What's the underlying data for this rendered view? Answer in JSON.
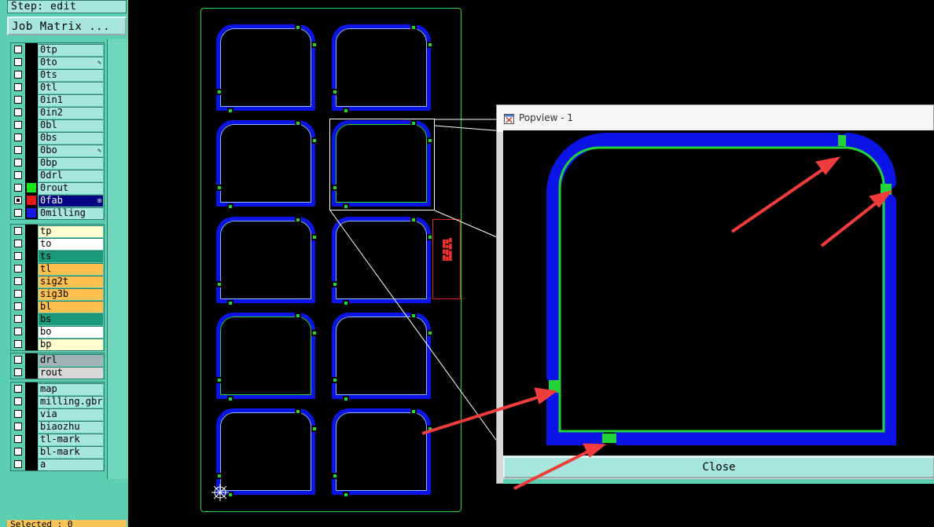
{
  "panel": {
    "step_label": "Step: edit",
    "job_matrix_button": "Job Matrix ...",
    "selected_label": "Selected : 0"
  },
  "layer_groups": [
    [
      {
        "name": "0tp",
        "checked": false,
        "color": "",
        "mark": ""
      },
      {
        "name": "0to",
        "checked": false,
        "color": "",
        "mark": "pencil"
      },
      {
        "name": "0ts",
        "checked": false,
        "color": "",
        "mark": ""
      },
      {
        "name": "0tl",
        "checked": false,
        "color": "",
        "mark": ""
      },
      {
        "name": "0in1",
        "checked": false,
        "color": "",
        "mark": ""
      },
      {
        "name": "0in2",
        "checked": false,
        "color": "",
        "mark": ""
      },
      {
        "name": "0bl",
        "checked": false,
        "color": "",
        "mark": ""
      },
      {
        "name": "0bs",
        "checked": false,
        "color": "",
        "mark": ""
      },
      {
        "name": "0bo",
        "checked": false,
        "color": "",
        "mark": "pencil"
      },
      {
        "name": "0bp",
        "checked": false,
        "color": "",
        "mark": ""
      },
      {
        "name": "0drl",
        "checked": false,
        "color": "",
        "mark": ""
      },
      {
        "name": "0rout",
        "checked": false,
        "color": "#19e619",
        "mark": ""
      },
      {
        "name": "0fab",
        "checked": true,
        "color": "#e61919",
        "mark": "grid",
        "name_bg": "#000080",
        "name_color": "#ffffff"
      },
      {
        "name": "0milling",
        "checked": false,
        "color": "#1919e6",
        "mark": ""
      }
    ],
    [
      {
        "name": "tp",
        "checked": false,
        "color": "",
        "name_bg": "#ffffd2"
      },
      {
        "name": "to",
        "checked": false,
        "color": "",
        "name_bg": "#ffffff"
      },
      {
        "name": "ts",
        "checked": false,
        "color": "",
        "name_bg": "#1a9a78"
      },
      {
        "name": "tl",
        "checked": false,
        "color": "",
        "name_bg": "#ffc050"
      },
      {
        "name": "sig2t",
        "checked": false,
        "color": "",
        "name_bg": "#ffc050"
      },
      {
        "name": "sig3b",
        "checked": false,
        "color": "",
        "name_bg": "#ffc050"
      },
      {
        "name": "bl",
        "checked": false,
        "color": "",
        "name_bg": "#ffc050"
      },
      {
        "name": "bs",
        "checked": false,
        "color": "",
        "name_bg": "#1a9a78"
      },
      {
        "name": "bo",
        "checked": false,
        "color": "",
        "name_bg": "#ffffff"
      },
      {
        "name": "bp",
        "checked": false,
        "color": "",
        "name_bg": "#ffffd2"
      }
    ],
    [
      {
        "name": "drl",
        "checked": false,
        "color": "",
        "name_bg": "#a0b4b4"
      },
      {
        "name": "rout",
        "checked": false,
        "color": "",
        "name_bg": "#d8d8d8"
      }
    ],
    [
      {
        "name": "map",
        "checked": false,
        "color": ""
      },
      {
        "name": "milling.gbr",
        "checked": false,
        "color": ""
      },
      {
        "name": "via",
        "checked": false,
        "color": ""
      },
      {
        "name": "biaozhu",
        "checked": false,
        "color": ""
      },
      {
        "name": "tl-mark",
        "checked": false,
        "color": ""
      },
      {
        "name": "bl-mark",
        "checked": false,
        "color": ""
      },
      {
        "name": "a",
        "checked": false,
        "color": ""
      }
    ]
  ],
  "popview": {
    "title": "Popview - 1",
    "close_label": "Close"
  },
  "colors": {
    "milling": "#0a14e6",
    "rout": "#22d33a",
    "arrow": "#f03c3c",
    "panel_bg": "#5ccfb0"
  },
  "icons": [
    "pencil-icon",
    "grid-icon",
    "popview-window-icon",
    "origin-crosshair-icon"
  ]
}
